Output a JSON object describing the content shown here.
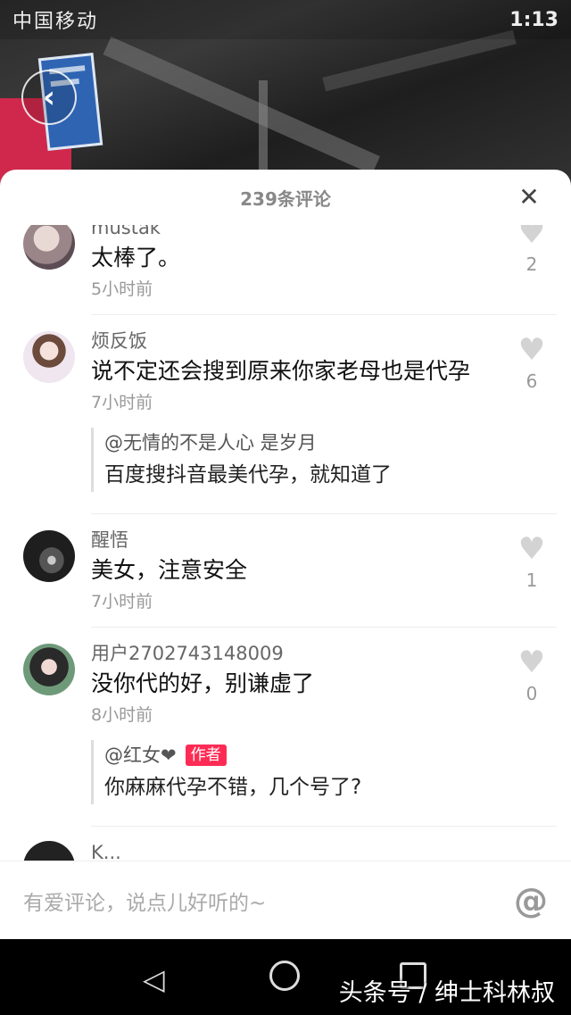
{
  "status_bar": {
    "carrier": "中国移动",
    "time": "1:13"
  },
  "sheet": {
    "title": "239条评论",
    "close_icon": "close-icon"
  },
  "comments": [
    {
      "username": "mustak",
      "content": "太棒了。",
      "time": "5小时前",
      "likes": "2"
    },
    {
      "username": "烦反饭",
      "content": "说不定还会搜到原来你家老母也是代孕",
      "time": "7小时前",
      "likes": "6",
      "reply": {
        "user": "@无情的不是人心  是岁月",
        "content": "百度搜抖音最美代孕，就知道了"
      }
    },
    {
      "username": "醒悟",
      "content": "美女，注意安全",
      "time": "7小时前",
      "likes": "1"
    },
    {
      "username": "用户2702743148009",
      "content": "没你代的好，别谦虚了",
      "time": "8小时前",
      "likes": "0",
      "reply": {
        "user": "@红女❤",
        "badge": "作者",
        "content": "你麻麻代孕不错，几个号了?"
      }
    },
    {
      "username": "K..."
    }
  ],
  "input": {
    "placeholder": "有爱评论，说点儿好听的~",
    "at_symbol": "@"
  },
  "watermark": "头条号 / 绅士科林叔"
}
